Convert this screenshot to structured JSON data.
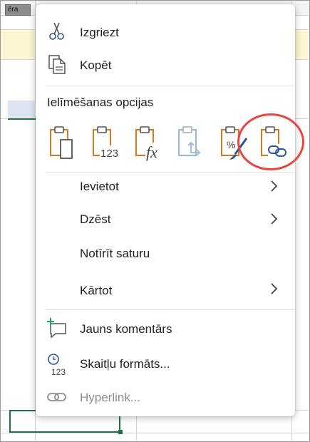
{
  "background": {
    "tab_text": "ēra",
    "accent_green": "#1e7145"
  },
  "menu": {
    "items_top": [
      {
        "id": "cut",
        "label": "Izgriezt",
        "icon": "scissors-icon"
      },
      {
        "id": "copy",
        "label": "Kopēt",
        "icon": "copy-icon"
      }
    ],
    "paste_options": {
      "title": "Ielīmēšanas opcijas",
      "buttons": [
        {
          "id": "keep-source-formatting",
          "icon": "paste-icon",
          "enabled": true
        },
        {
          "id": "values",
          "icon": "paste-values-icon",
          "sub_text": "123",
          "enabled": true
        },
        {
          "id": "formulas",
          "icon": "paste-formulas-icon",
          "sub_text": "fx",
          "enabled": true
        },
        {
          "id": "transpose",
          "icon": "paste-transpose-icon",
          "enabled": false
        },
        {
          "id": "formatting",
          "icon": "paste-formatting-icon",
          "enabled": true
        },
        {
          "id": "paste-link",
          "icon": "paste-link-icon",
          "enabled": true,
          "highlighted": true
        }
      ],
      "highlight_color": "#e8473f"
    },
    "items_mid": [
      {
        "id": "insert",
        "label": "Ievietot",
        "submenu": true
      },
      {
        "id": "delete",
        "label": "Dzēst",
        "submenu": true
      },
      {
        "id": "clear",
        "label": "Notīrīt saturu",
        "submenu": false
      },
      {
        "id": "sort",
        "label": "Kārtot",
        "submenu": true
      }
    ],
    "items_bottom": [
      {
        "id": "new-comment",
        "label": "Jauns komentārs",
        "icon": "new-comment-icon"
      },
      {
        "id": "number-format",
        "label": "Skaitļu formāts...",
        "icon": "number-format-icon",
        "icon_text": "123"
      },
      {
        "id": "hyperlink",
        "label": "Hyperlink...",
        "icon": "link-icon",
        "enabled": false
      }
    ],
    "colors": {
      "icon_blue": "#2b579a",
      "icon_orange": "#d47a1e",
      "icon_green": "#21a366",
      "disabled": "#8d8d8d"
    }
  }
}
